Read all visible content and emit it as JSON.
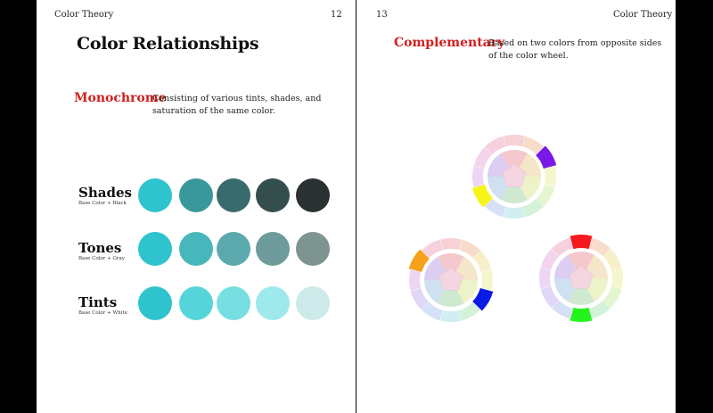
{
  "left_page": {
    "header_title": "Color Theory",
    "page_number": "12",
    "title": "Color Relationships",
    "monochrome": {
      "label": "Monochrome",
      "description": "Consisting of various tints, shades, and saturation of the same color."
    },
    "rows": [
      {
        "label": "Shades",
        "sub": "Base Color + Black",
        "colors": [
          "#2ec3cd",
          "#38989c",
          "#3a6b6c",
          "#344e4d",
          "#2b3032"
        ]
      },
      {
        "label": "Tones",
        "sub": "Base Color + Gray",
        "colors": [
          "#2ec3cd",
          "#48b7bc",
          "#5ba9ac",
          "#6e9b9b",
          "#7d9491"
        ]
      },
      {
        "label": "Tints",
        "sub": "Base Color + White",
        "colors": [
          "#2ec3cd",
          "#55d4d9",
          "#77dfe2",
          "#9ee9ec",
          "#cde9ea"
        ]
      }
    ]
  },
  "right_page": {
    "header_title": "Color Theory",
    "page_number": "13",
    "complementary": {
      "label": "Complementary",
      "description": "Based on two colors from opposite sides of the color wheel."
    },
    "wheels": [
      {
        "highlight_a": "#7a18e8",
        "highlight_b": "#f7f41a"
      },
      {
        "highlight_a": "#f8a11d",
        "highlight_b": "#0b1be6"
      },
      {
        "highlight_a": "#f5191f",
        "highlight_b": "#24f41b"
      }
    ]
  }
}
